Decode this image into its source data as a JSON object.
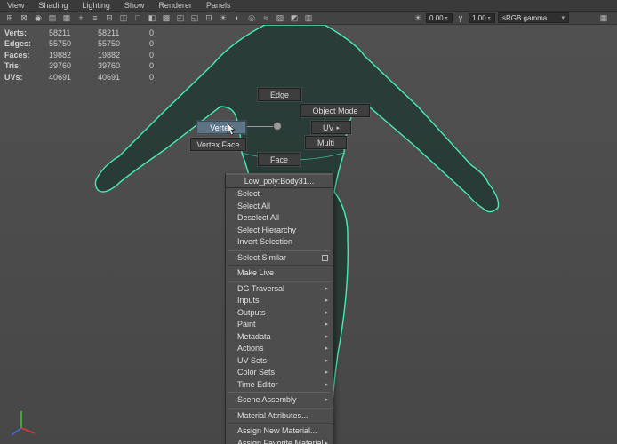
{
  "menubar": {
    "items": [
      {
        "label": "View",
        "name": "menu-view"
      },
      {
        "label": "Shading",
        "name": "menu-shading"
      },
      {
        "label": "Lighting",
        "name": "menu-lighting"
      },
      {
        "label": "Show",
        "name": "menu-show"
      },
      {
        "label": "Renderer",
        "name": "menu-renderer"
      },
      {
        "label": "Panels",
        "name": "menu-panels"
      }
    ]
  },
  "toolbar": {
    "icons": [
      {
        "name": "select-camera-icon",
        "glyph": "⊞"
      },
      {
        "name": "lock-camera-icon",
        "glyph": "⊠"
      },
      {
        "name": "camera-attributes-icon",
        "glyph": "◉"
      },
      {
        "name": "bookmarks-icon",
        "glyph": "▤"
      },
      {
        "name": "image-plane-icon",
        "glyph": "▦"
      },
      {
        "name": "pan-zoom-2d-icon",
        "glyph": "+"
      },
      {
        "name": "grease-pencil-icon",
        "glyph": "≡"
      },
      {
        "name": "grid-icon",
        "glyph": "⊟"
      },
      {
        "name": "film-gate-icon",
        "glyph": "◫"
      },
      {
        "name": "resolution-gate-icon",
        "glyph": "□"
      },
      {
        "name": "gate-mask-icon",
        "glyph": "◧"
      },
      {
        "name": "field-chart-icon",
        "glyph": "▩"
      },
      {
        "name": "safe-action-icon",
        "glyph": "◰"
      },
      {
        "name": "safe-title-icon",
        "glyph": "◱"
      },
      {
        "name": "frame-all-icon",
        "glyph": "⊡"
      },
      {
        "name": "lighting-icon",
        "glyph": "☀"
      },
      {
        "name": "shadows-icon",
        "glyph": "◐"
      },
      {
        "name": "ambient-occlusion-icon",
        "glyph": "◎"
      },
      {
        "name": "motion-blur-icon",
        "glyph": "≈"
      },
      {
        "name": "multisample-icon",
        "glyph": "▨"
      },
      {
        "name": "isolate-select-icon",
        "glyph": "◩"
      },
      {
        "name": "xray-icon",
        "glyph": "▥"
      }
    ],
    "exposure": {
      "glyph": "☀",
      "value": "0.00"
    },
    "gamma": {
      "glyph": "γ",
      "value": "1.00"
    },
    "view_transform": {
      "value": "sRGB gamma"
    },
    "trailing_icon": {
      "glyph": "▦"
    }
  },
  "hud": {
    "rows": [
      {
        "label": "Verts:",
        "col1": "58211",
        "col2": "58211",
        "col3": "0"
      },
      {
        "label": "Edges:",
        "col1": "55750",
        "col2": "55750",
        "col3": "0"
      },
      {
        "label": "Faces:",
        "col1": "19882",
        "col2": "19882",
        "col3": "0"
      },
      {
        "label": "Tris:",
        "col1": "39760",
        "col2": "39760",
        "col3": "0"
      },
      {
        "label": "UVs:",
        "col1": "40691",
        "col2": "40691",
        "col3": "0"
      }
    ]
  },
  "marking_menu": {
    "items": [
      {
        "label": "Edge"
      },
      {
        "label": "Object Mode"
      },
      {
        "label": "UV",
        "arrow": true
      },
      {
        "label": "Multi"
      },
      {
        "label": "Vertex",
        "highlighted": true
      },
      {
        "label": "Vertex Face"
      },
      {
        "label": "Face"
      }
    ]
  },
  "context_menu": {
    "title": "Low_poly:Body31...",
    "items": [
      {
        "label": "Select"
      },
      {
        "label": "Select All"
      },
      {
        "label": "Deselect All"
      },
      {
        "label": "Select Hierarchy"
      },
      {
        "label": "Invert Selection",
        "sep_after": true
      },
      {
        "label": "Select Similar",
        "optionbox": true,
        "sep_after": true
      },
      {
        "label": "Make Live",
        "sep_after": true
      },
      {
        "label": "DG Traversal",
        "arrow": true
      },
      {
        "label": "Inputs",
        "arrow": true
      },
      {
        "label": "Outputs",
        "arrow": true
      },
      {
        "label": "Paint",
        "arrow": true
      },
      {
        "label": "Metadata",
        "arrow": true
      },
      {
        "label": "Actions",
        "arrow": true
      },
      {
        "label": "UV Sets",
        "arrow": true
      },
      {
        "label": "Color Sets",
        "arrow": true
      },
      {
        "label": "Time Editor",
        "arrow": true,
        "sep_after": true
      },
      {
        "label": "Scene Assembly",
        "arrow": true,
        "sep_after": true
      },
      {
        "label": "Material Attributes...",
        "sep_after": true
      },
      {
        "label": "Assign New Material..."
      },
      {
        "label": "Assign Favorite Material",
        "arrow": true
      }
    ]
  },
  "colors": {
    "wireframe": "#3fe6ad",
    "marking_highlight": "#5d7386",
    "viewport_bg": "#4b4b4b"
  }
}
